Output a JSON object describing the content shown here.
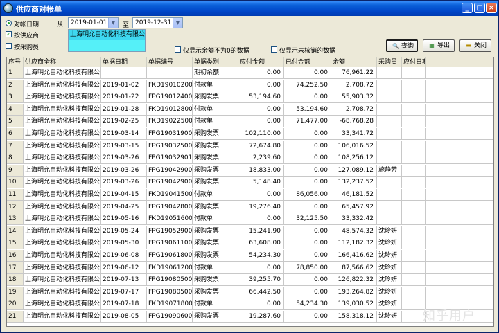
{
  "window": {
    "title": "供应商对帐单"
  },
  "filters": {
    "radio_date_label": "对帐日期",
    "from_label": "从",
    "from_date": "2019-01-01",
    "to_label": "至",
    "to_date": "2019-12-31",
    "by_supplier_label": "按供应商",
    "by_buyer_label": "按采购员",
    "supplier_value": "上海明允自动化科技有限公司",
    "show_nonzero_label": "仅显示余额不为0的数据",
    "show_unverified_label": "仅显示未核销的数据"
  },
  "buttons": {
    "query": "查询",
    "export": "导出",
    "close": "关闭"
  },
  "table": {
    "columns": [
      "序号",
      "供应商全称",
      "单据日期",
      "单据编号",
      "单据类别",
      "应付金额",
      "已付金额",
      "余额",
      "采购员",
      "应付日期"
    ],
    "rows": [
      [
        "1",
        "上海明允自动化科技有限公司",
        "",
        "",
        "期初余额",
        "0.00",
        "0.00",
        "76,961.22",
        "",
        ""
      ],
      [
        "2",
        "上海明允自动化科技有限公司",
        "2019-01-02",
        "FKD190102003",
        "付款单",
        "0.00",
        "74,252.50",
        "2,708.72",
        "",
        ""
      ],
      [
        "3",
        "上海明允自动化科技有限公司",
        "2019-01-22",
        "FPG190124002",
        "采购发票",
        "53,194.60",
        "0.00",
        "55,903.32",
        "",
        ""
      ],
      [
        "4",
        "上海明允自动化科技有限公司",
        "2019-01-28",
        "FKD190128001",
        "付款单",
        "0.00",
        "53,194.60",
        "2,708.72",
        "",
        ""
      ],
      [
        "5",
        "上海明允自动化科技有限公司",
        "2019-02-25",
        "FKD190225001",
        "付款单",
        "0.00",
        "71,477.00",
        "-68,768.28",
        "",
        ""
      ],
      [
        "6",
        "上海明允自动化科技有限公司",
        "2019-03-14",
        "FPG190319007",
        "采购发票",
        "102,110.00",
        "0.00",
        "33,341.72",
        "",
        ""
      ],
      [
        "7",
        "上海明允自动化科技有限公司",
        "2019-03-15",
        "FPG190325005",
        "采购发票",
        "72,674.80",
        "0.00",
        "106,016.52",
        "",
        ""
      ],
      [
        "8",
        "上海明允自动化科技有限公司",
        "2019-03-26",
        "FPG190329013",
        "采购发票",
        "2,239.60",
        "0.00",
        "108,256.12",
        "",
        ""
      ],
      [
        "9",
        "上海明允自动化科技有限公司",
        "2019-03-26",
        "FPG190429001",
        "采购发票",
        "18,833.00",
        "0.00",
        "127,089.12",
        "施静芳",
        ""
      ],
      [
        "10",
        "上海明允自动化科技有限公司",
        "2019-03-26",
        "FPG190429002",
        "采购发票",
        "5,148.40",
        "0.00",
        "132,237.52",
        "",
        ""
      ],
      [
        "11",
        "上海明允自动化科技有限公司",
        "2019-04-15",
        "FKD190415001",
        "付款单",
        "0.00",
        "86,056.00",
        "46,181.52",
        "",
        ""
      ],
      [
        "12",
        "上海明允自动化科技有限公司",
        "2019-04-25",
        "FPG190428003",
        "采购发票",
        "19,276.40",
        "0.00",
        "65,457.92",
        "",
        ""
      ],
      [
        "13",
        "上海明允自动化科技有限公司",
        "2019-05-16",
        "FKD190516003",
        "付款单",
        "0.00",
        "32,125.50",
        "33,332.42",
        "",
        ""
      ],
      [
        "14",
        "上海明允自动化科技有限公司",
        "2019-05-24",
        "FPG190529001",
        "采购发票",
        "15,241.90",
        "0.00",
        "48,574.32",
        "沈玲妍",
        ""
      ],
      [
        "15",
        "上海明允自动化科技有限公司",
        "2019-05-30",
        "FPG190611002",
        "采购发票",
        "63,608.00",
        "0.00",
        "112,182.32",
        "沈玲妍",
        ""
      ],
      [
        "16",
        "上海明允自动化科技有限公司",
        "2019-06-08",
        "FPG190618001",
        "采购发票",
        "54,234.30",
        "0.00",
        "166,416.62",
        "沈玲妍",
        ""
      ],
      [
        "17",
        "上海明允自动化科技有限公司",
        "2019-06-12",
        "FKD190612003",
        "付款单",
        "0.00",
        "78,850.00",
        "87,566.62",
        "沈玲妍",
        ""
      ],
      [
        "18",
        "上海明允自动化科技有限公司",
        "2019-07-13",
        "FPG190805002",
        "采购发票",
        "39,255.70",
        "0.00",
        "126,822.32",
        "沈玲妍",
        ""
      ],
      [
        "19",
        "上海明允自动化科技有限公司",
        "2019-07-17",
        "FPG190805001",
        "采购发票",
        "66,442.50",
        "0.00",
        "193,264.82",
        "沈玲妍",
        ""
      ],
      [
        "20",
        "上海明允自动化科技有限公司",
        "2019-07-18",
        "FKD190718004",
        "付款单",
        "0.00",
        "54,234.30",
        "139,030.52",
        "沈玲妍",
        ""
      ],
      [
        "21",
        "上海明允自动化科技有限公司",
        "2019-08-05",
        "FPG190906002",
        "采购发票",
        "19,287.60",
        "0.00",
        "158,318.12",
        "沈玲妍",
        ""
      ]
    ]
  },
  "watermark": "知乎用户",
  "colors": {
    "title_bar": "#0a5fd8",
    "supplier_highlight": "#3ed8f0",
    "supplier_box": "#55f0f8",
    "close_button": "#c63b12"
  }
}
